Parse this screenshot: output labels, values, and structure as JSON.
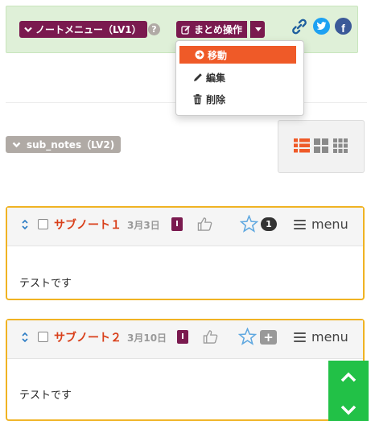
{
  "toolbar": {
    "note_menu_label": "ノートメニュー（LV1）",
    "help_symbol": "?",
    "bulk_actions_label": "まとめ操作",
    "icons": [
      "chevron-down-icon",
      "help-icon",
      "edit-icon",
      "caret-down-icon",
      "link-icon",
      "twitter-icon",
      "facebook-icon"
    ],
    "facebook_letter": "f"
  },
  "dropdown": {
    "items": [
      {
        "label": "移動",
        "icon": "arrow-right-circle-icon",
        "active": true
      },
      {
        "label": "編集",
        "icon": "pencil-icon",
        "active": false
      },
      {
        "label": "削除",
        "icon": "trash-icon",
        "active": false
      }
    ]
  },
  "sub_notes": {
    "label": "sub_notes（LV2)",
    "views": [
      "list-view-icon",
      "grid-view-icon",
      "small-grid-view-icon"
    ],
    "active_view": "list-view-icon"
  },
  "notes": [
    {
      "title": "サブノート１",
      "date": "3月3日",
      "importance": "I",
      "star_count": "1",
      "menu_label": "menu",
      "body": "テストです"
    },
    {
      "title": "サブノート２",
      "date": "3月10日",
      "importance": "I",
      "plus_symbol": "+",
      "menu_label": "menu",
      "body": "テストです"
    }
  ],
  "colors": {
    "accent_purple": "#7a1a4f",
    "accent_orange": "#ef5a28",
    "toolbar_bg": "#dff0d8",
    "card_border": "#f0b323",
    "scroll_green": "#22c147"
  }
}
